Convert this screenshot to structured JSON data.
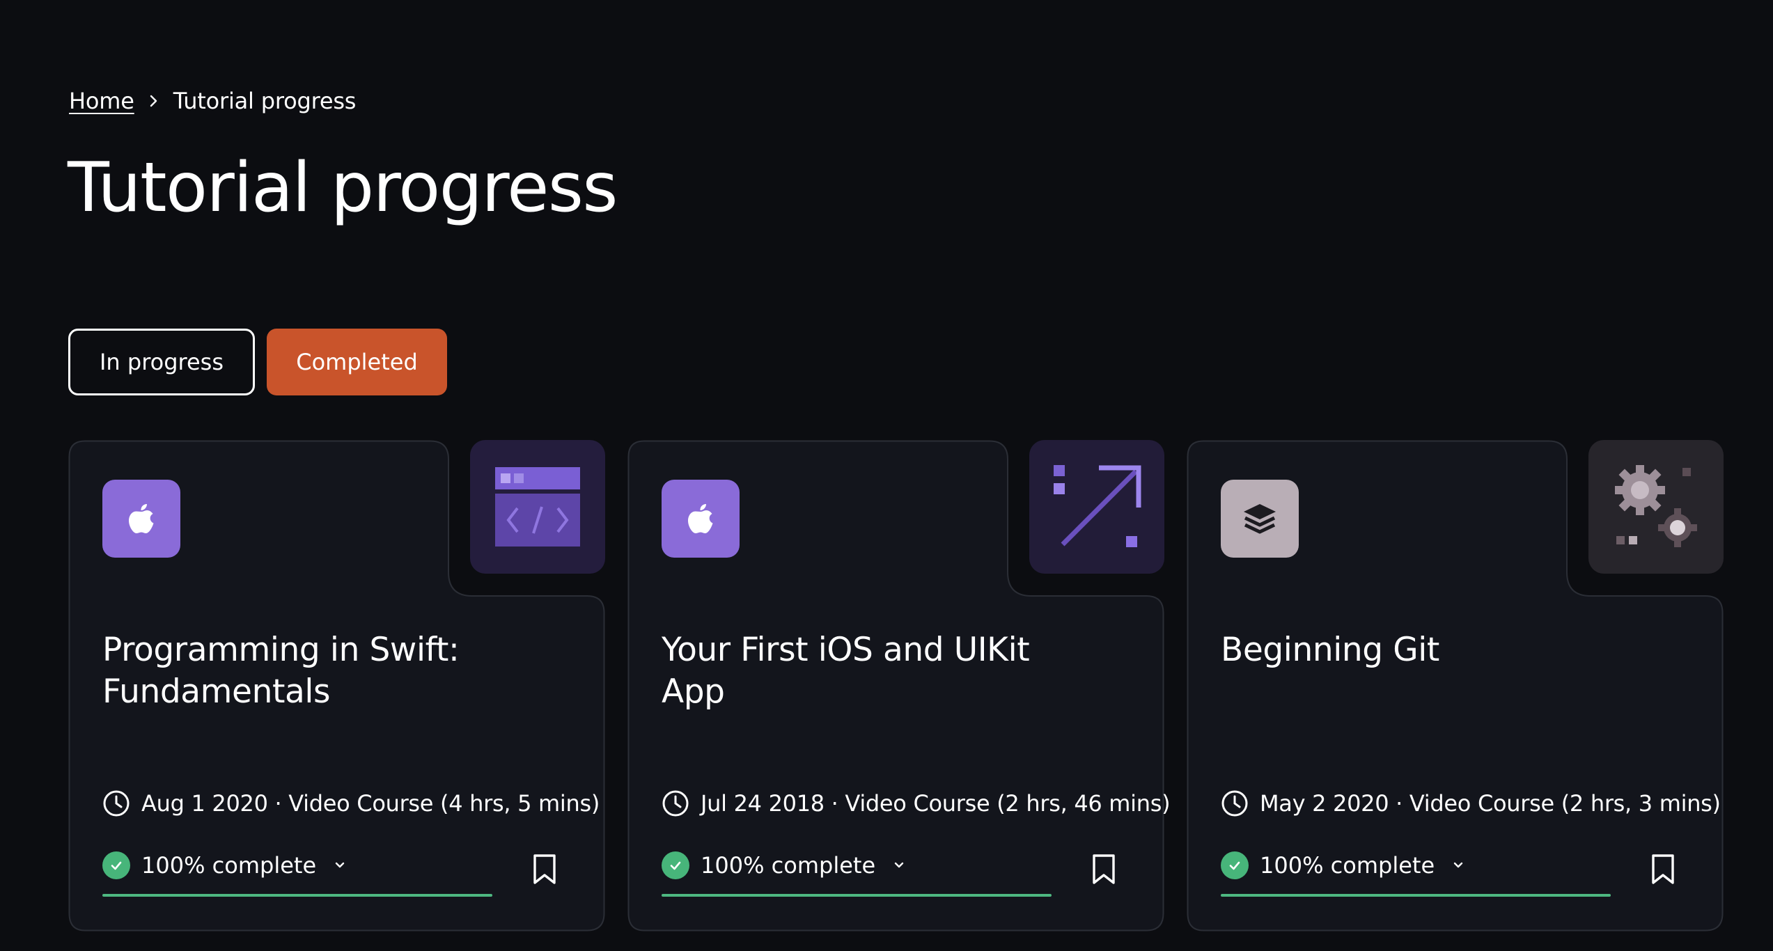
{
  "breadcrumb": {
    "home_label": "Home",
    "current_label": "Tutorial progress"
  },
  "page_title": "Tutorial progress",
  "filters": {
    "in_progress_label": "In progress",
    "completed_label": "Completed",
    "active": "Completed"
  },
  "colors": {
    "background": "#0c0d11",
    "card_background": "#13151c",
    "accent_orange": "#c9542b",
    "apple_badge": "#8a6bd8",
    "git_badge": "#b9aeb6",
    "progress_green": "#4eb881"
  },
  "cards": [
    {
      "platform_icon": "apple-icon",
      "art_icon": "code-window-icon",
      "title": "Programming in Swift: Fundamentals",
      "meta": "Aug 1 2020 · Video Course (4 hrs, 5 mins)",
      "progress_label": "100% complete",
      "progress": 1.0
    },
    {
      "platform_icon": "apple-icon",
      "art_icon": "arrow-up-right-icon",
      "title": "Your First iOS and UIKit App",
      "meta": "Jul 24 2018 · Video Course (2 hrs, 46 mins)",
      "progress_label": "100% complete",
      "progress": 1.0
    },
    {
      "platform_icon": "layers-icon",
      "art_icon": "gears-icon",
      "title": "Beginning Git",
      "meta": "May 2 2020 · Video Course (2 hrs, 3 mins)",
      "progress_label": "100% complete",
      "progress": 1.0
    }
  ]
}
